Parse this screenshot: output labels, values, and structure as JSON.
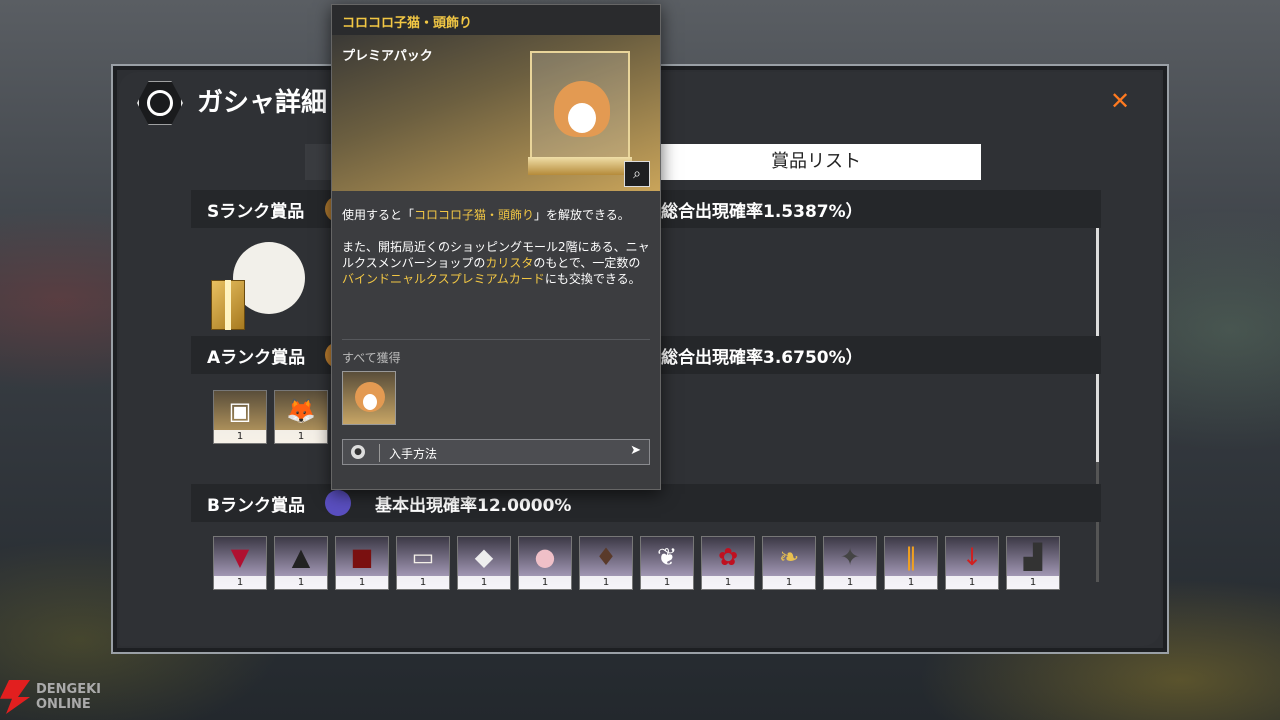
{
  "window": {
    "title": "ガシャ詳細",
    "close_icon": "close-icon"
  },
  "tabs": {
    "prize_list_label": "賞品リスト"
  },
  "ranks": {
    "s": {
      "label": "Sランク賞品",
      "rate": "総合出現確率1.5387%）"
    },
    "a": {
      "label": "Aランク賞品",
      "rate": "総合出現確率3.6750%）"
    },
    "b": {
      "label": "Bランク賞品",
      "rate": "基本出現確率12.0000%"
    }
  },
  "a_items": [
    {
      "icon": "ticket-icon",
      "qty": "1"
    },
    {
      "icon": "fox-case-icon",
      "qty": "1"
    }
  ],
  "b_items": [
    {
      "icon": "red-shirt-icon",
      "qty": "1"
    },
    {
      "icon": "black-coat-icon",
      "qty": "1"
    },
    {
      "icon": "jacket-icon",
      "qty": "1"
    },
    {
      "icon": "skirt-icon",
      "qty": "1"
    },
    {
      "icon": "hood-icon",
      "qty": "1"
    },
    {
      "icon": "pig-icon",
      "qty": "1"
    },
    {
      "icon": "hair-icon",
      "qty": "1"
    },
    {
      "icon": "wing-icon",
      "qty": "1"
    },
    {
      "icon": "rose-icon",
      "qty": "1"
    },
    {
      "icon": "ribbon-icon",
      "qty": "1"
    },
    {
      "icon": "bat-icon",
      "qty": "1"
    },
    {
      "icon": "clip-icon",
      "qty": "1"
    },
    {
      "icon": "arrow-icon",
      "qty": "1"
    },
    {
      "icon": "shoes-icon",
      "qty": "1"
    }
  ],
  "popup": {
    "title": "コロコロ子猫・頭飾り",
    "type": "プレミアパック",
    "desc1_pre": "使用すると「",
    "desc1_hl": "コロコロ子猫・頭飾り",
    "desc1_post": "」を解放できる。",
    "desc2_a": "また、開拓局近くのショッピングモール2階にある、ニャルクスメンバーショップの",
    "desc2_hl1": "カリスタ",
    "desc2_b": "のもとで、一定数の",
    "desc2_hl2": "バインドニャルクスプレミアムカード",
    "desc2_c": "にも交換できる。",
    "get_all_label": "すべて獲得",
    "acquire_label": "入手方法"
  },
  "watermark": {
    "line1": "DENGEKI",
    "line2": "ONLINE"
  },
  "colors": {
    "accent_gold": "#f2c744",
    "close_orange": "#ff7a20",
    "panel_bg": "#2f3135"
  }
}
